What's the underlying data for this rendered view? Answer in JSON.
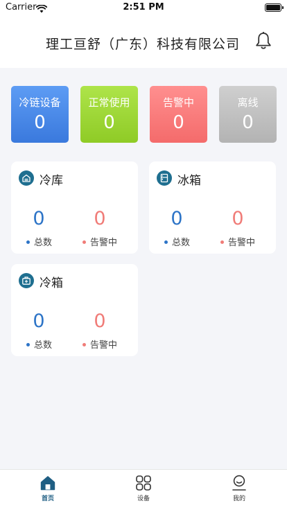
{
  "status_bar": {
    "carrier": "Carrier",
    "time": "2:51 PM"
  },
  "header": {
    "title": "理工亘舒（广东）科技有限公司",
    "notification_icon": "bell-icon"
  },
  "summary": [
    {
      "label": "冷链设备",
      "value": "0",
      "color": "#4a8ae8"
    },
    {
      "label": "正常使用",
      "value": "0",
      "color": "#9fd63a"
    },
    {
      "label": "告警中",
      "value": "0",
      "color": "#f77b7b"
    },
    {
      "label": "离线",
      "value": "0",
      "color": "#c0c0c0"
    }
  ],
  "cards": [
    {
      "name": "冷库",
      "icon": "cold-storage-icon",
      "total": "0",
      "total_label": "总数",
      "alarm": "0",
      "alarm_label": "告警中"
    },
    {
      "name": "冰箱",
      "icon": "fridge-icon",
      "total": "0",
      "total_label": "总数",
      "alarm": "0",
      "alarm_label": "告警中"
    },
    {
      "name": "冷箱",
      "icon": "cold-box-icon",
      "total": "0",
      "total_label": "总数",
      "alarm": "0",
      "alarm_label": "告警中"
    }
  ],
  "tabs": [
    {
      "label": "首页",
      "icon": "home-icon",
      "active": true
    },
    {
      "label": "设备",
      "icon": "devices-grid-icon",
      "active": false
    },
    {
      "label": "我的",
      "icon": "user-icon",
      "active": false
    }
  ],
  "colors": {
    "accent": "#1f6f90",
    "total_blue": "#2d74c7",
    "alarm_red": "#f07c78"
  }
}
